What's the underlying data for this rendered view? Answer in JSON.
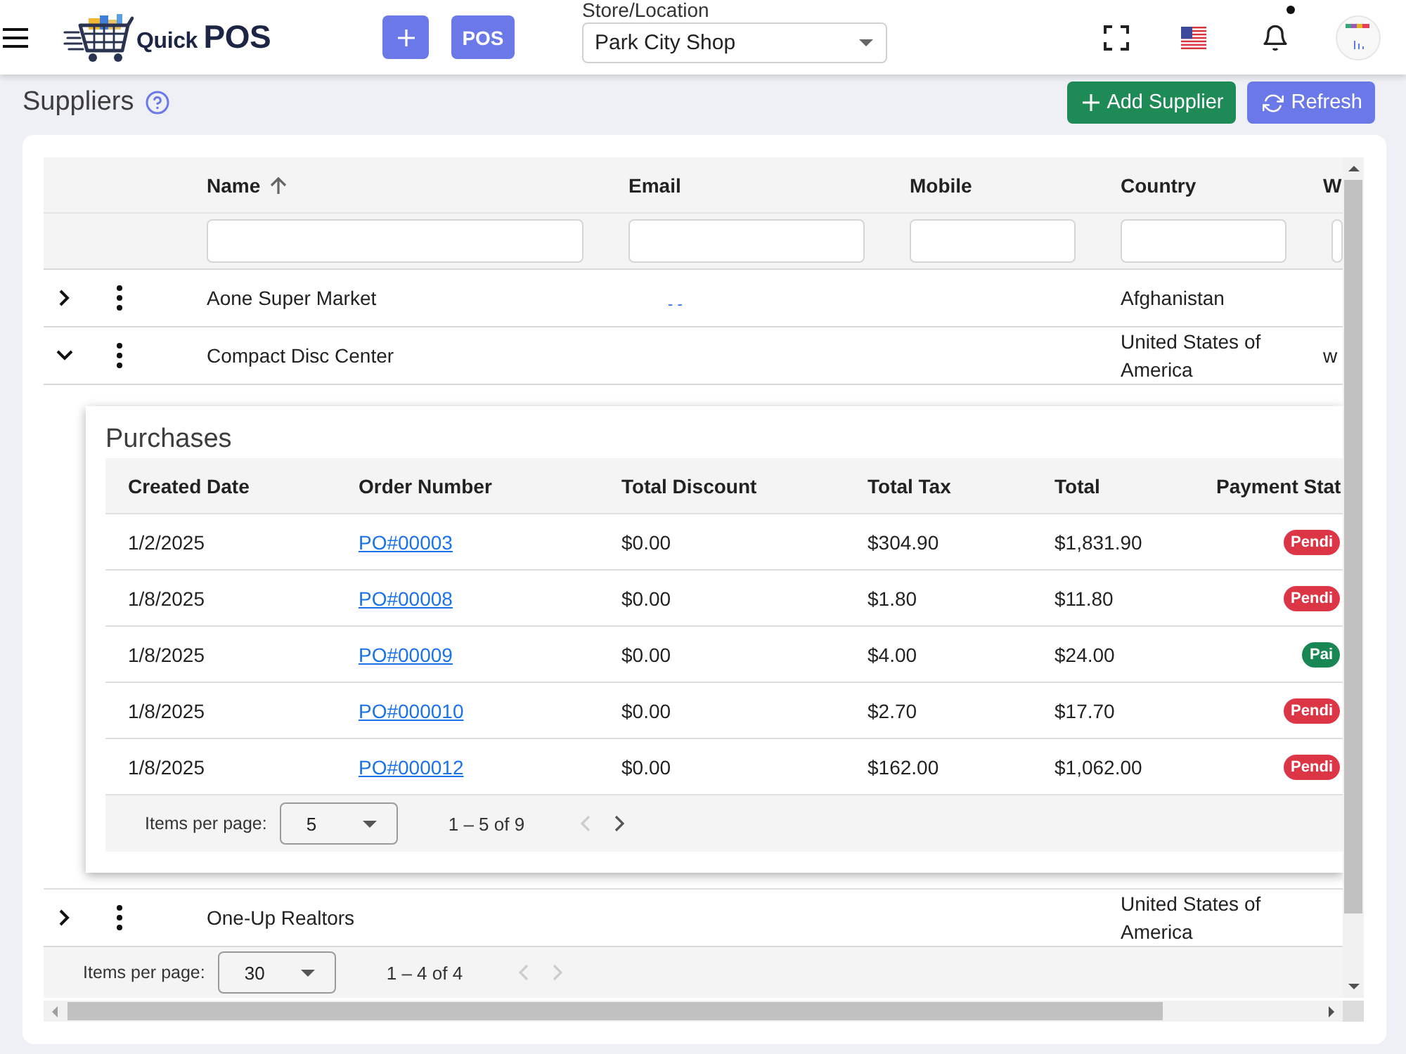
{
  "header": {
    "logo_text": "Quick **POS**",
    "pos_button": "POS",
    "store_selector": {
      "label": "Store/Location",
      "value": "Park City Shop"
    },
    "notifications": {
      "unread": true
    }
  },
  "page": {
    "title": "Suppliers",
    "buttons": [
      {
        "kind": "add",
        "label": "Add Supplier"
      },
      {
        "kind": "refresh",
        "label": "Refresh"
      }
    ]
  },
  "table": {
    "columns": [
      {
        "label": "Name",
        "sorted": true
      },
      {
        "label": "Email",
        "sorted": false
      },
      {
        "label": "Mobile",
        "sorted": false
      },
      {
        "label": "Country",
        "sorted": false
      },
      {
        "label": "W",
        "sorted": false
      }
    ],
    "rows": [
      {
        "expanded": false,
        "name": "Aone Super Market",
        "email": "- -",
        "country": "Afghanistan"
      },
      {
        "expanded": true,
        "name": "Compact Disc Center",
        "country": "United States of America",
        "column_5": "w",
        "purchases": {
          "title": "Purchases",
          "columns": [
            "Created Date",
            "Order Number",
            "Total Discount",
            "Total Tax",
            "Total",
            "Payment Stat"
          ],
          "rows": [
            {
              "created_date": "1/2/2025",
              "order_number": "PO#00003",
              "total_discount": "$0.00",
              "total_tax": "$304.90",
              "total": "$1,831.90",
              "payment_status": {
                "label": "Pendi",
                "color": "#dc3545"
              }
            },
            {
              "created_date": "1/8/2025",
              "order_number": "PO#00008",
              "total_discount": "$0.00",
              "total_tax": "$1.80",
              "total": "$11.80",
              "payment_status": {
                "label": "Pendi",
                "color": "#dc3545"
              }
            },
            {
              "created_date": "1/8/2025",
              "order_number": "PO#00009",
              "total_discount": "$0.00",
              "total_tax": "$4.00",
              "total": "$24.00",
              "payment_status": {
                "label": "Pai",
                "color": "#198754"
              }
            },
            {
              "created_date": "1/8/2025",
              "order_number": "PO#000010",
              "total_discount": "$0.00",
              "total_tax": "$2.70",
              "total": "$17.70",
              "payment_status": {
                "label": "Pendi",
                "color": "#dc3545"
              }
            },
            {
              "created_date": "1/8/2025",
              "order_number": "PO#000012",
              "total_discount": "$0.00",
              "total_tax": "$162.00",
              "total": "$1,062.00",
              "payment_status": {
                "label": "Pendi",
                "color": "#dc3545"
              }
            }
          ],
          "paginator": {
            "label": "Items per page:",
            "page_size": "5",
            "range": "1 – 5 of 9",
            "previous": {
              "disabled": true
            },
            "next": {
              "disabled": false
            }
          }
        }
      },
      {
        "expanded": false,
        "name": "One-Up Realtors",
        "country": "United States of America"
      }
    ],
    "paginator": {
      "label": "Items per page:",
      "page_size": "30",
      "range": "1 – 4 of 4",
      "previous": {
        "disabled": true
      },
      "next": {
        "disabled": true
      }
    }
  }
}
